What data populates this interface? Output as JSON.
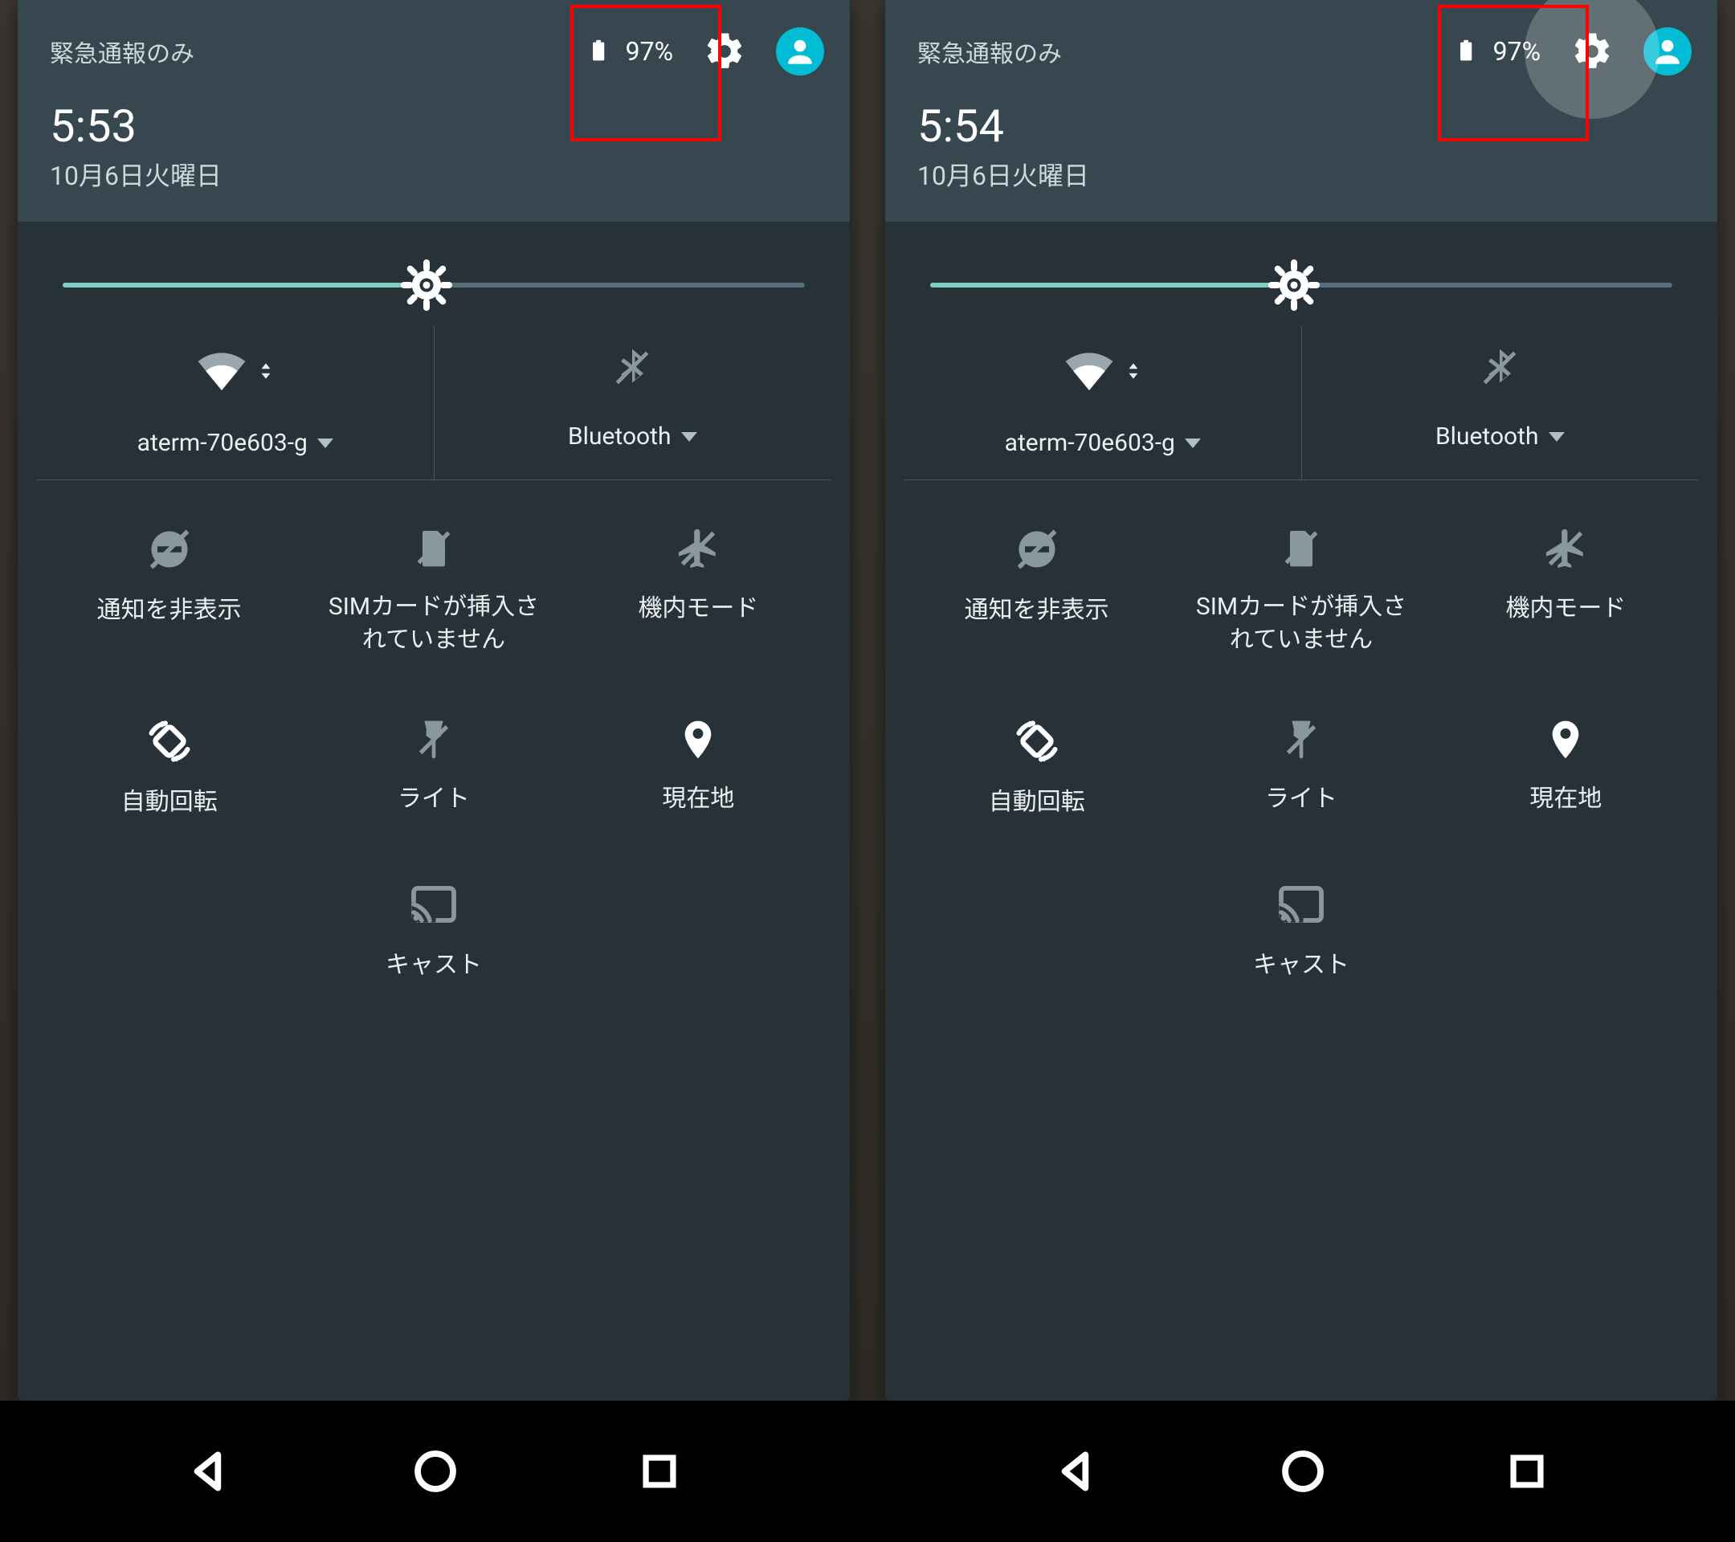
{
  "screens": [
    {
      "status": {
        "network": "緊急通報のみ",
        "battery_pct": "97%"
      },
      "time": "5:53",
      "date": "10月6日火曜日",
      "brightness_pct": 49,
      "gear_highlight": {
        "ripple": false,
        "redbox": true
      },
      "wifi": {
        "label": "aterm-70e603-g"
      },
      "bluetooth": {
        "label": "Bluetooth"
      },
      "tiles": {
        "dnd": "通知を非表示",
        "sim": "SIMカードが挿入さ\nれていません",
        "airplane": "機内モード",
        "rotate": "自動回転",
        "flashlight": "ライト",
        "location": "現在地",
        "cast": "キャスト"
      }
    },
    {
      "status": {
        "network": "緊急通報のみ",
        "battery_pct": "97%"
      },
      "time": "5:54",
      "date": "10月6日火曜日",
      "brightness_pct": 49,
      "gear_highlight": {
        "ripple": true,
        "redbox": true
      },
      "wifi": {
        "label": "aterm-70e603-g"
      },
      "bluetooth": {
        "label": "Bluetooth"
      },
      "tiles": {
        "dnd": "通知を非表示",
        "sim": "SIMカードが挿入さ\nれていません",
        "airplane": "機内モード",
        "rotate": "自動回転",
        "flashlight": "ライト",
        "location": "現在地",
        "cast": "キャスト"
      }
    }
  ]
}
